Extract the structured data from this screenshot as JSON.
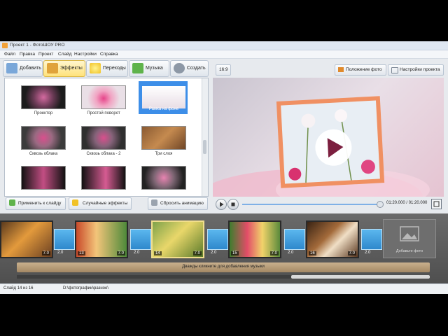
{
  "window": {
    "title": "Проект 1 - ФотоШОУ PRO"
  },
  "menu": [
    "Файл",
    "Правка",
    "Проект",
    "Слайд",
    "Настройки",
    "Справка"
  ],
  "tabs": [
    {
      "label": "Добавить",
      "icon": "photo-add-icon"
    },
    {
      "label": "Эффекты",
      "icon": "effects-icon",
      "active": true
    },
    {
      "label": "Переходы",
      "icon": "star-transition-icon"
    },
    {
      "label": "Музыка",
      "icon": "music-note-icon"
    },
    {
      "label": "Создать",
      "icon": "film-reel-icon"
    }
  ],
  "toolbar_right": {
    "aspect": "16:9",
    "photo_position": "Положение фото",
    "project_settings": "Настройки проекта"
  },
  "effects": [
    {
      "label": "Проектор"
    },
    {
      "label": "Простой поворот"
    },
    {
      "label": "Рамка на фоне",
      "selected": true
    },
    {
      "label": "Сквозь облака"
    },
    {
      "label": "Сквозь облака - 2"
    },
    {
      "label": "Три слоя"
    },
    {
      "label": ""
    },
    {
      "label": ""
    },
    {
      "label": ""
    }
  ],
  "effect_buttons": {
    "apply": "Применить к слайду",
    "random": "Случайные эффекты",
    "reset": "Сбросить анимацию"
  },
  "player": {
    "time": "01:20.000 / 01:20.000",
    "progress": 0.98
  },
  "timeline": {
    "slides": [
      {
        "num": "",
        "dur": "7.0"
      },
      {
        "num": "13",
        "dur": "7.0"
      },
      {
        "num": "14",
        "dur": "7.0",
        "selected": true
      },
      {
        "num": "15",
        "dur": "7.0"
      },
      {
        "num": "16",
        "dur": "7.0"
      }
    ],
    "transitions": [
      "2.0",
      "2.0",
      "2.0",
      "2.0",
      "2.0"
    ],
    "add_photo": "Добавьте фото",
    "music_hint": "Дважды кликните для добавления музыки"
  },
  "status": {
    "slide": "Слайд 14 из 16",
    "path": "D:\\фотографии\\разное\\"
  },
  "colors": {
    "accent_tab": "#ffe27a",
    "selection": "#3d8ee8",
    "transition": "#2e88cc"
  }
}
